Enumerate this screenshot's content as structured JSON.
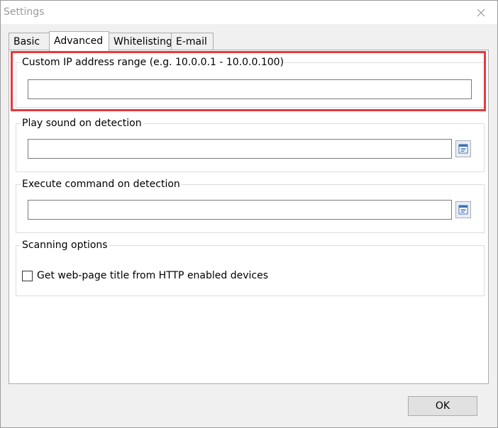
{
  "window": {
    "title": "Settings"
  },
  "tabs": [
    {
      "label": "Basic",
      "active": false
    },
    {
      "label": "Advanced",
      "active": true
    },
    {
      "label": "Whitelisting",
      "active": false
    },
    {
      "label": "E-mail",
      "active": false
    }
  ],
  "groups": {
    "custom_ip": {
      "label": "Custom IP address range (e.g. 10.0.0.1 - 10.0.0.100)",
      "value": ""
    },
    "play_sound": {
      "label": "Play sound on detection",
      "value": ""
    },
    "execute_command": {
      "label": "Execute command on detection",
      "value": ""
    },
    "scanning": {
      "label": "Scanning options",
      "checkbox_label": "Get web-page title from HTTP enabled devices",
      "checked": false
    }
  },
  "buttons": {
    "ok_label": "OK"
  },
  "colors": {
    "highlight": "#e8393c",
    "panel_bg": "#ffffff",
    "window_bg": "#f0f0f0"
  }
}
